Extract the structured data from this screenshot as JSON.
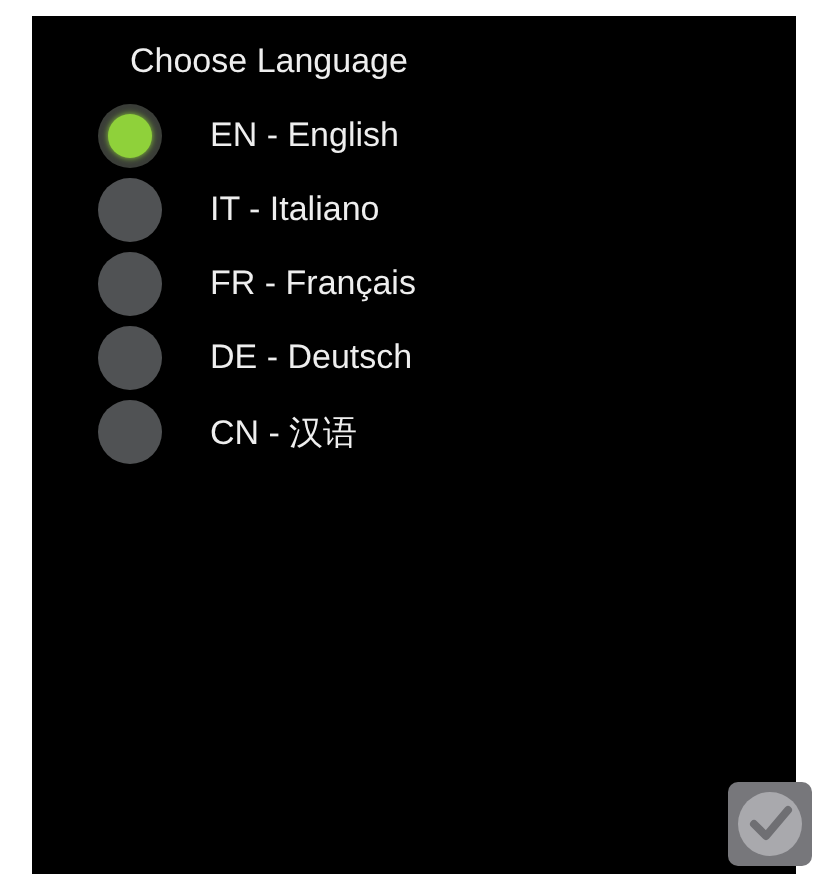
{
  "title": "Choose Language",
  "languages": [
    {
      "label": "EN - English",
      "selected": true
    },
    {
      "label": "IT - Italiano",
      "selected": false
    },
    {
      "label": "FR - Français",
      "selected": false
    },
    {
      "label": "DE - Deutsch",
      "selected": false
    },
    {
      "label": "CN - 汉语",
      "selected": false
    }
  ],
  "confirm_button": {
    "kind": "check"
  }
}
